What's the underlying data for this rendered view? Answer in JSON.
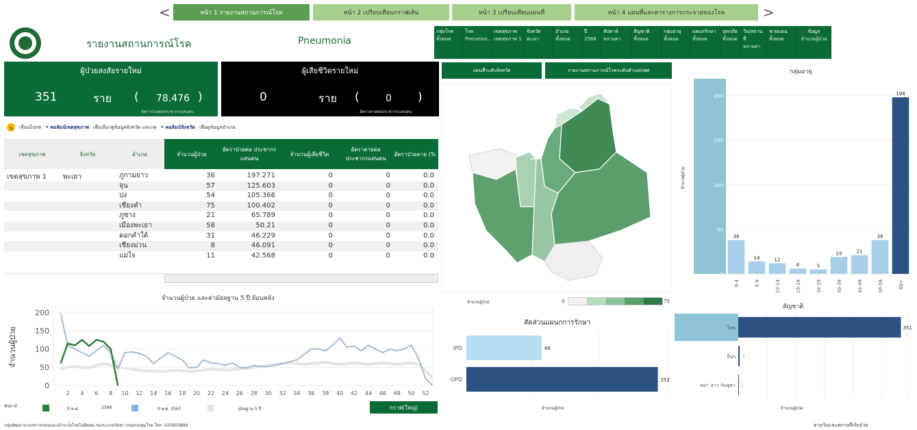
{
  "nav": {
    "prev": "<",
    "next": ">",
    "tabs": [
      {
        "label": "หน้า 1 รายงานสถานการณ์โรค",
        "active": true
      },
      {
        "label": "หน้า 2 เปรียบเทียบกราฟเส้น",
        "active": false
      },
      {
        "label": "หน้า 3 เปรียบเทียบแผนที่",
        "active": false
      },
      {
        "label": "หน้า 4 แผนที่และตารางการกระจายของโรค",
        "active": false
      }
    ]
  },
  "header": {
    "title": "รายงานสถานการณ์โรค",
    "disease": "Pneumonia"
  },
  "filters": [
    {
      "label": "กลุ่มโรค",
      "value": "ทั้งหมด"
    },
    {
      "label": "โรค",
      "value": "Pneumon.."
    },
    {
      "label": "เขตสุขภาพ",
      "value": "เขตสุขภาพ 1"
    },
    {
      "label": "จังหวัด",
      "value": "พะเยา"
    },
    {
      "label": "อำเภอ",
      "value": "ทั้งหมด"
    },
    {
      "label": "ปี",
      "value": "2568"
    },
    {
      "label": "สัปดาห์",
      "value": "หลายค่า"
    },
    {
      "label": "สัญชาติ",
      "value": "ทั้งหมด"
    },
    {
      "label": "กลุ่มอายุ",
      "value": "ทั้งหมด"
    },
    {
      "label": "แผนกรักษา",
      "value": "ทั้งหมด"
    },
    {
      "label": "อุทกภัย",
      "value": "ทั้งหมด"
    },
    {
      "label": "วัน/สถานที่",
      "value": "หลายค่า"
    },
    {
      "label": "ชายแดน",
      "value": "ทั้งหมด"
    },
    {
      "label": "ข้อมูล",
      "value": "จำนวนผู้ป่วย"
    }
  ],
  "kpi_cases": {
    "title": "ผู้ป่วยสงสัยรายใหม่",
    "value": "351",
    "unit": "ราย",
    "open": "(",
    "rate": "78.476",
    "close": ")",
    "rate_label": "อัตราป่วยต่อประชากรแสนคน"
  },
  "kpi_deaths": {
    "title": "ผู้เสียชีวิตรายใหม่",
    "value": "0",
    "unit": "ราย",
    "open": "(",
    "rate": "0",
    "close": ")",
    "rate_label": "อัตราตายต่อประชากรแสนคน"
  },
  "hint": {
    "icon": "arrow-down-right-icon",
    "text1": "เลื่อนไปกด",
    "bold1": "• คอลัมน์เขตสุขภาพ",
    "text2": "เพื่อเลือกดูข้อมูลจังหวัด และกด",
    "bold2": "• คอลัมน์จังหวัด",
    "text3": "เพื่อดูข้อมูลอำเภอ"
  },
  "table": {
    "headers": [
      "เขตสุขภาพ",
      "จังหวัด",
      "อำเภอ",
      "จำนวนผู้ป่วย",
      "อัตราป่วยต่อ ประชากรแสนคน",
      "จำนวนผู้เสียชีวิต",
      "อัตราตายต่อ ประชากรแสนคน",
      "อัตราป่วยตาย (%"
    ],
    "region": "เขตสุขภาพ 1",
    "province": "พะเยา",
    "rows": [
      {
        "district": "ภูกามยาว",
        "cases": "36",
        "rate": "197.271",
        "deaths": "0",
        "drate": "0",
        "cfr": "0.0"
      },
      {
        "district": "จุน",
        "cases": "57",
        "rate": "125.603",
        "deaths": "0",
        "drate": "0",
        "cfr": "0.0"
      },
      {
        "district": "ปง",
        "cases": "54",
        "rate": "105.366",
        "deaths": "0",
        "drate": "0",
        "cfr": "0.0"
      },
      {
        "district": "เชียงคำ",
        "cases": "75",
        "rate": "100.402",
        "deaths": "0",
        "drate": "0",
        "cfr": "0.0"
      },
      {
        "district": "ภูซาง",
        "cases": "21",
        "rate": "65.789",
        "deaths": "0",
        "drate": "0",
        "cfr": "0.0"
      },
      {
        "district": "เมืองพะเยา",
        "cases": "58",
        "rate": "50.21",
        "deaths": "0",
        "drate": "0",
        "cfr": "0.0"
      },
      {
        "district": "ดอกคำใต้",
        "cases": "31",
        "rate": "46.229",
        "deaths": "0",
        "drate": "0",
        "cfr": "0.0"
      },
      {
        "district": "เชียงม่วน",
        "cases": "8",
        "rate": "46.091",
        "deaths": "0",
        "drate": "0",
        "cfr": "0.0"
      },
      {
        "district": "แม่ใจ",
        "cases": "11",
        "rate": "42.568",
        "deaths": "0",
        "drate": "0",
        "cfr": "0.0"
      }
    ]
  },
  "map_buttons": {
    "left": "แผนที่ระดับจังหวัด",
    "right": "รายงานสถานการณ์โรคระดับตำบล/เพศ"
  },
  "map_legend": {
    "label": "จำนวนผู้ป่วย",
    "min": "0",
    "max": "75",
    "colors": [
      "#f2f2f2",
      "#b7dcbe",
      "#8cc39a",
      "#5a9e6b",
      "#2f7a45"
    ]
  },
  "footer": {
    "credit": "กลุ่มพัฒนาระบบข่าวกรองและเฝ้าระวังโรคไม่ติดต่อ  กองระบาดวิทยา  กรมควบคุมโรค  โทร: 025903899",
    "legend_week": "สัปดาห์",
    "legend_cur": "2568",
    "legend_cur_prefix": "0 พ.ศ.",
    "legend_prev": "0 พ.ศ. 2567",
    "legend_median": "มัธยฐาน 5 ปี",
    "big_graph": "กราฟ(ใหญ่)",
    "onset_note": "ตามวันและสถานที่เริ่มป่วย"
  },
  "chart_data": [
    {
      "type": "line",
      "title": "จำนวนผู้ป่วย และค่ามัธยฐาน 5 ปี ย้อนหลัง",
      "ylabel": "จำนวนผู้ป่วย",
      "xlabel": "",
      "x_ticks": [
        "2",
        "4",
        "6",
        "8",
        "10",
        "12",
        "14",
        "16",
        "18",
        "20",
        "22",
        "24",
        "26",
        "28",
        "30",
        "32",
        "34",
        "36",
        "38",
        "40",
        "42",
        "44",
        "46",
        "48",
        "50",
        "52"
      ],
      "y_ticks": [
        "0",
        "50",
        "100",
        "150",
        "200"
      ],
      "ylim": [
        0,
        210
      ],
      "xlim": [
        0,
        53
      ],
      "series": [
        {
          "name": "2568",
          "color": "#2e7d32",
          "x": [
            1,
            2,
            3,
            4,
            5,
            6,
            7,
            8,
            9
          ],
          "values": [
            60,
            115,
            110,
            125,
            108,
            125,
            120,
            100,
            0
          ]
        },
        {
          "name": "0 พ.ศ. 2567",
          "color": "#9db4cf",
          "x": [
            1,
            2,
            3,
            4,
            5,
            6,
            7,
            8,
            9,
            10,
            11,
            12,
            13,
            14,
            15,
            16,
            17,
            18,
            19,
            20,
            21,
            22,
            23,
            24,
            25,
            26,
            27,
            28,
            29,
            30,
            31,
            32,
            33,
            34,
            35,
            36,
            37,
            38,
            39,
            40,
            41,
            42,
            43,
            44,
            45,
            46,
            47,
            48,
            49,
            50,
            51,
            52,
            53
          ],
          "values": [
            198,
            110,
            100,
            90,
            80,
            95,
            110,
            90,
            45,
            90,
            92,
            88,
            80,
            60,
            75,
            90,
            80,
            70,
            48,
            50,
            70,
            62,
            60,
            55,
            62,
            50,
            48,
            55,
            52,
            52,
            55,
            60,
            65,
            70,
            85,
            100,
            100,
            95,
            110,
            130,
            105,
            108,
            95,
            110,
            100,
            90,
            100,
            95,
            100,
            110,
            75,
            18,
            0
          ]
        },
        {
          "name": "มัธยฐาน 5 ปี",
          "color": "#e6e6e6",
          "x": [
            1,
            2,
            3,
            4,
            5,
            6,
            7,
            8,
            9,
            10,
            11,
            12,
            13,
            14,
            15,
            16,
            17,
            18,
            19,
            20,
            21,
            22,
            23,
            24,
            25,
            26,
            27,
            28,
            29,
            30,
            31,
            32,
            33,
            34,
            35,
            36,
            37,
            38,
            39,
            40,
            41,
            42,
            43,
            44,
            45,
            46,
            47,
            48,
            49,
            50,
            51,
            52,
            53
          ],
          "values": [
            45,
            50,
            52,
            50,
            48,
            55,
            60,
            55,
            50,
            48,
            45,
            42,
            40,
            40,
            38,
            40,
            42,
            40,
            38,
            40,
            42,
            45,
            44,
            42,
            44,
            45,
            48,
            50,
            52,
            55,
            58,
            60,
            62,
            60,
            58,
            60,
            62,
            64,
            60,
            58,
            60,
            62,
            60,
            58,
            60,
            62,
            60,
            58,
            60,
            62,
            58,
            40,
            20
          ]
        }
      ]
    },
    {
      "type": "bar",
      "title": "กลุ่มอายุ",
      "ylabel": "จำนวนผู้ป่วย",
      "categories": [
        "0-4",
        "5-9",
        "10-14",
        "15-19",
        "20-29",
        "30-39",
        "40-49",
        "50-59",
        "60+"
      ],
      "values": [
        38,
        14,
        12,
        6,
        5,
        19,
        21,
        38,
        198
      ],
      "y_ticks": [
        "0",
        "50",
        "100",
        "150",
        "200"
      ],
      "ylim": [
        0,
        215
      ],
      "colors": [
        "#a8cfe9",
        "#a8cfe9",
        "#a8cfe9",
        "#a8cfe9",
        "#a8cfe9",
        "#a8cfe9",
        "#a8cfe9",
        "#a8cfe9",
        "#2b5283"
      ]
    },
    {
      "type": "bar",
      "orientation": "horizontal",
      "title": "สัดส่วนแผนกการรักษา",
      "xlabel": "จำนวนผู้ป่วย",
      "categories": [
        "IPD",
        "OPD"
      ],
      "values": [
        99,
        252
      ],
      "xlim": [
        0,
        265
      ],
      "colors": [
        "#b7dbf2",
        "#2b5283"
      ]
    },
    {
      "type": "bar",
      "orientation": "horizontal",
      "title": "สัญชาติ",
      "xlabel": "จำนวนผู้ป่วย",
      "categories": [
        "ไทย",
        "อื่นๆ",
        "พม่า ลาว กัมพูชา"
      ],
      "values": [
        351,
        3,
        1
      ],
      "xlim": [
        0,
        365
      ],
      "colors": [
        "#2b5283",
        "#2b5283",
        "#2b5283"
      ]
    }
  ]
}
